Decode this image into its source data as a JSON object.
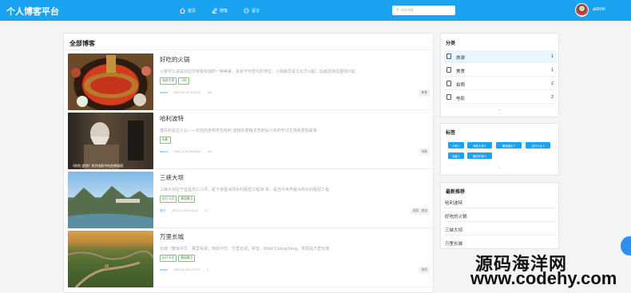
{
  "header": {
    "brand": "个人博客平台",
    "nav": [
      {
        "label": "首页",
        "icon": "home-icon"
      },
      {
        "label": "随笔",
        "icon": "edit-icon"
      },
      {
        "label": "留言",
        "icon": "message-icon"
      }
    ],
    "search_placeholder": "搜索博客",
    "username": "admin"
  },
  "main": {
    "title": "全部博客",
    "posts": [
      {
        "title": "好吃的火锅",
        "desc": "火锅可以说是现在非常受欢迎的一种美食，具有不可替代的地位，火锅最早是在北方兴起，后面逐渐在整地兴起",
        "tags": [
          "海底大捞",
          "小吃"
        ],
        "author": "admin",
        "date": "2022-05-10 20:12:02",
        "views": "106",
        "category": "美食"
      },
      {
        "title": "哈利波特",
        "desc": "描写的是主人公——年轻的巫师学生哈利·波特在霍格沃茨前后六年的学习生活和冒险故事",
        "tags": [
          "电影"
        ],
        "author": "admin",
        "date": "2022-01-09 09:44:53",
        "views": "180",
        "category": "电影",
        "thumb_caption": "《哈利·波特》系列电影中的经典剧照"
      },
      {
        "title": "三峡大坝",
        "desc": "三峡大坝位于宜昌市三斗坪，距下游葛洲坝水利枢纽工程38 米，是当今世界最大的水利枢纽工程",
        "tags": [
          "必打卡点",
          "最值最点"
        ],
        "author": "吾兮",
        "date": "2022-01-04 14:21:21",
        "views": "8",
        "category": "拍照 , 旅游"
      },
      {
        "title": "万里长城",
        "desc": "长城（繁体中文：萬里長城；简体中文：万里长城；拼音：Wànlǐ Chángchéng，意思是万里长城",
        "tags": [
          "必打卡点",
          "最值最点"
        ],
        "author": "admin",
        "date": "2022-01-02 21:37:07",
        "views": "4",
        "category": "拍照"
      }
    ]
  },
  "sidebar": {
    "categories_title": "分类",
    "categories": [
      {
        "name": "旅游",
        "count": "1"
      },
      {
        "name": "美食",
        "count": "1"
      },
      {
        "name": "拍照",
        "count": "2"
      },
      {
        "name": "电影",
        "count": "2"
      }
    ],
    "tags_title": "标签",
    "tags": [
      "小吃 1",
      "海底大捞 1",
      "最值最点 2",
      "必打卡点 2",
      "电影 1",
      "最好的场 0"
    ],
    "recommend_title": "最新推荐",
    "recommend": [
      "哈利波特",
      "好吃的火锅",
      "三峡大坝",
      "万里长城"
    ]
  },
  "watermark": {
    "line1": "源码海洋网",
    "line2": "www.codehy.com"
  },
  "colors": {
    "accent": "#1aa3f0",
    "tag_green": "#3b9b3b"
  }
}
